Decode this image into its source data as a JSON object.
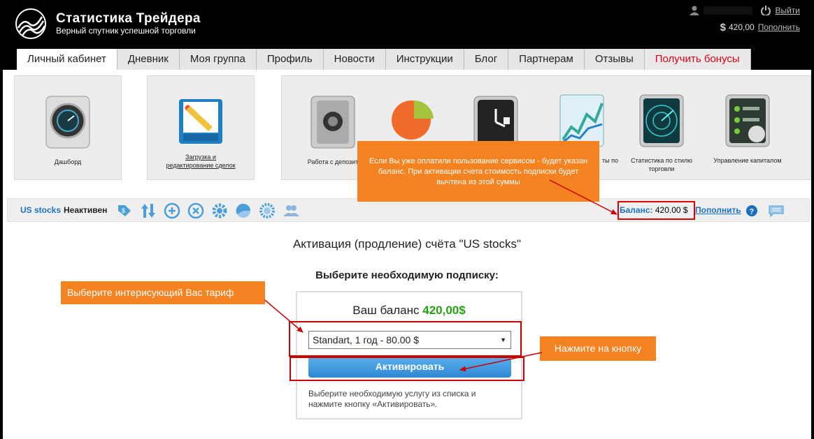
{
  "header": {
    "brand_title": "Статистика Трейдера",
    "brand_subtitle": "Верный спутник успешной торговли",
    "logout": "Выйти",
    "balance": "420,00",
    "topup": "Пополнить"
  },
  "tabs": [
    {
      "label": "Личный кабинет"
    },
    {
      "label": "Дневник"
    },
    {
      "label": "Моя группа"
    },
    {
      "label": "Профиль"
    },
    {
      "label": "Новости"
    },
    {
      "label": "Инструкции"
    },
    {
      "label": "Блог"
    },
    {
      "label": "Партнерам"
    },
    {
      "label": "Отзывы"
    },
    {
      "label": "Получить бонусы"
    }
  ],
  "tiles": {
    "dashboard": "Дашборд",
    "upload_line1": "Загрузка и",
    "upload_line2": "редактирование сделок",
    "deposit": "Работа с депозит",
    "reports": "ты по",
    "style_line1": "Статистика по стилю",
    "style_line2": "торговли",
    "capital": "Управление капиталом"
  },
  "toolbar": {
    "account": "US stocks",
    "status": "Неактивен",
    "balance_label": "Баланс:",
    "balance_value": "420.00 $",
    "topup": "Пополнить"
  },
  "main": {
    "page_title": "Активация (продление) счёта \"US stocks\"",
    "choose": "Выберите необходимую подписку:",
    "your_balance": "Ваш баланс",
    "balance_amount": "420,00$",
    "selected_plan": "Standart, 1 год - 80.00 $",
    "activate": "Активировать",
    "hint_line1": "Выберите необходимую услугу из списка и",
    "hint_line2": "нажмите кнопку «Активировать»."
  },
  "callouts": {
    "balance_note": "Если Вы уже оплатили пользование сервисом - будет указан баланс. При активации счета стоимость подписки будет вычтена из этой суммы",
    "choose_tariff": "Выберите интерисующий Вас тариф",
    "press_button": "Нажмите на кнопку"
  },
  "colors": {
    "accent_blue": "#1a73c2",
    "balance_green": "#25a014",
    "callout_orange": "#f58220",
    "highlight_red": "#cc0000",
    "bonus_red": "#e2001a"
  }
}
